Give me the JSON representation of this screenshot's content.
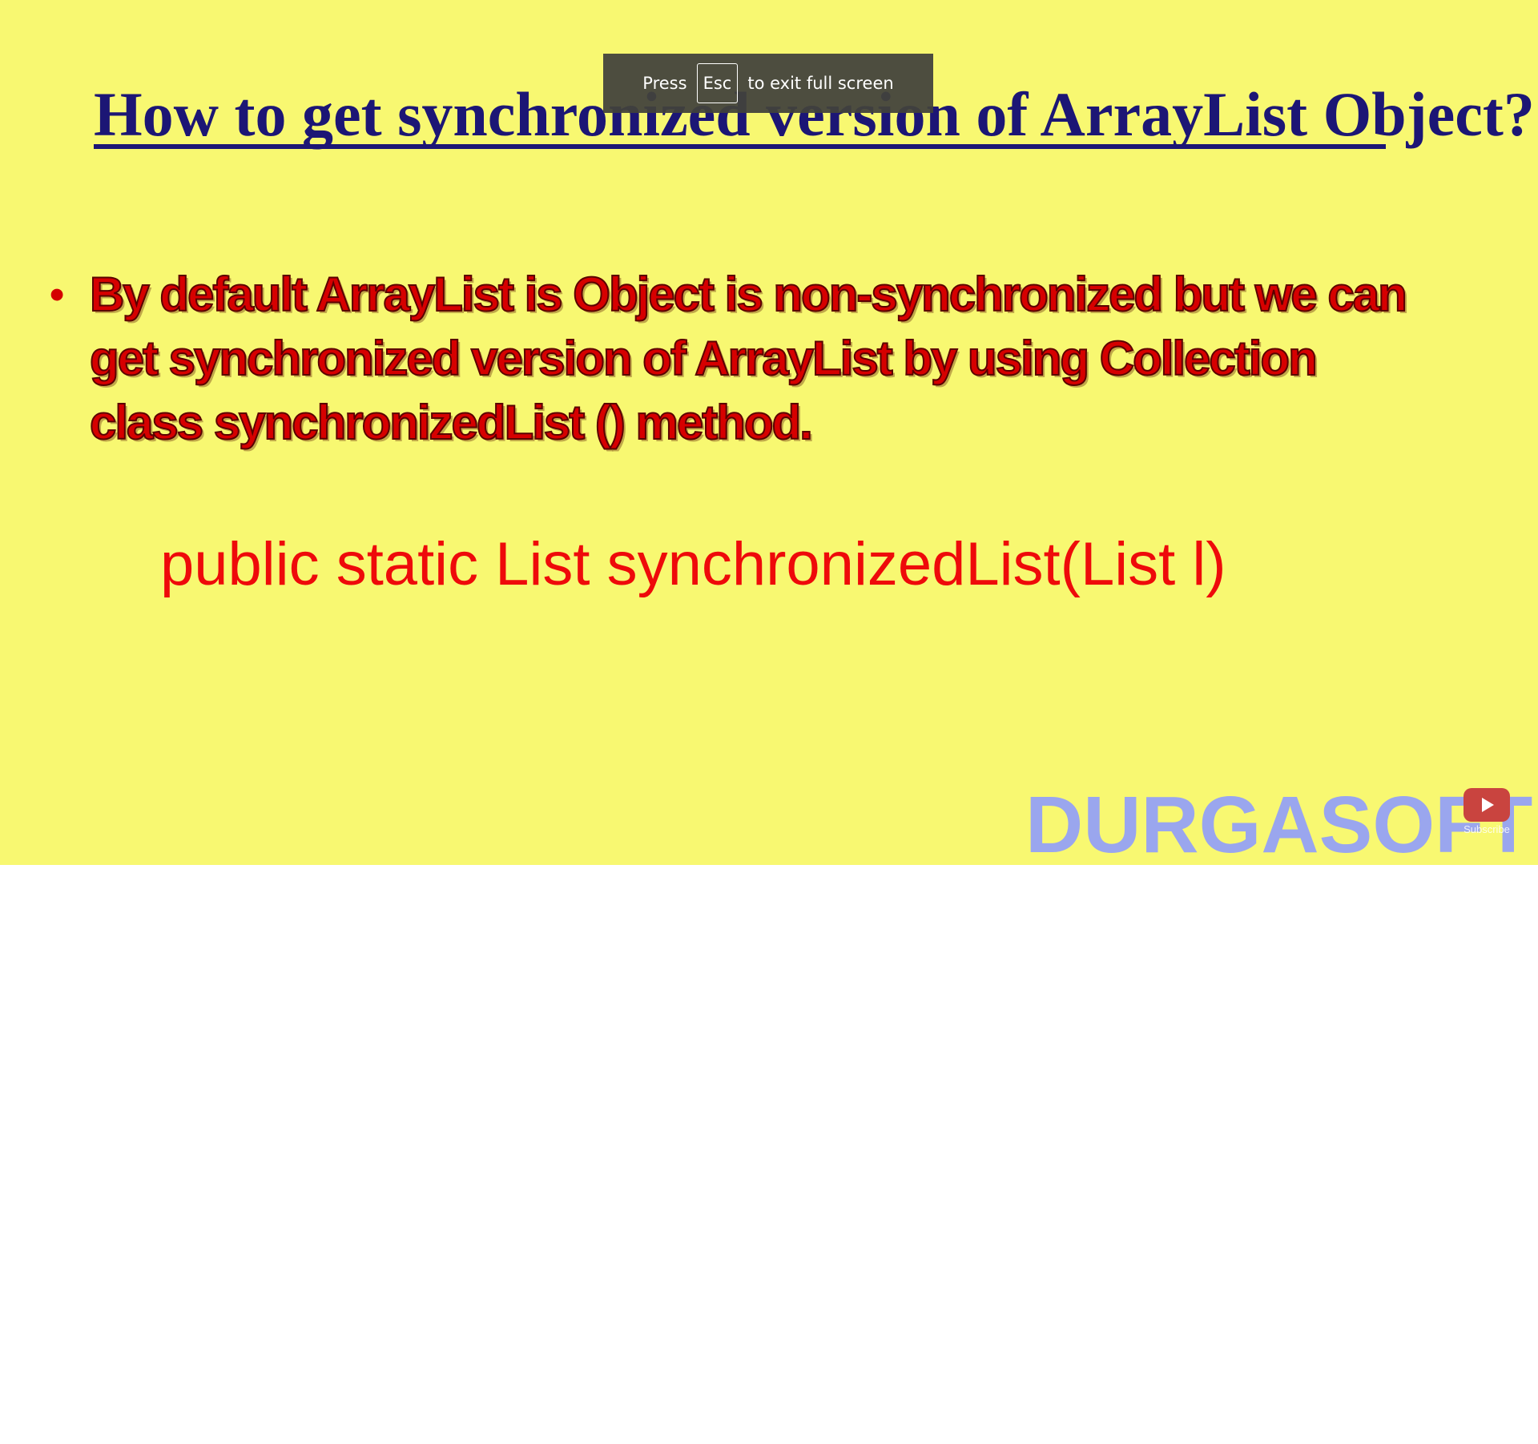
{
  "slide": {
    "title": "How to get synchronized version of ArrayList Object?",
    "bullet": "By default ArrayList is Object is non-synchronized but we can get synchronized version of ArrayList by using Collection class synchronizedList () method.",
    "signature": "public static List synchronizedList(List l)",
    "watermark": "DURGASOFT"
  },
  "subscribe": {
    "label": "Subscribe",
    "icon": "youtube-play-icon"
  },
  "fullscreen_notice": {
    "prefix": "Press",
    "key": "Esc",
    "suffix": "to exit full screen"
  },
  "colors": {
    "slide_background": "#f8f871",
    "title": "#1c1675",
    "bullet_text": "#d60000",
    "signature": "#ee0a0a",
    "watermark": "#9aa6ee",
    "toast_background": "#42423c"
  }
}
